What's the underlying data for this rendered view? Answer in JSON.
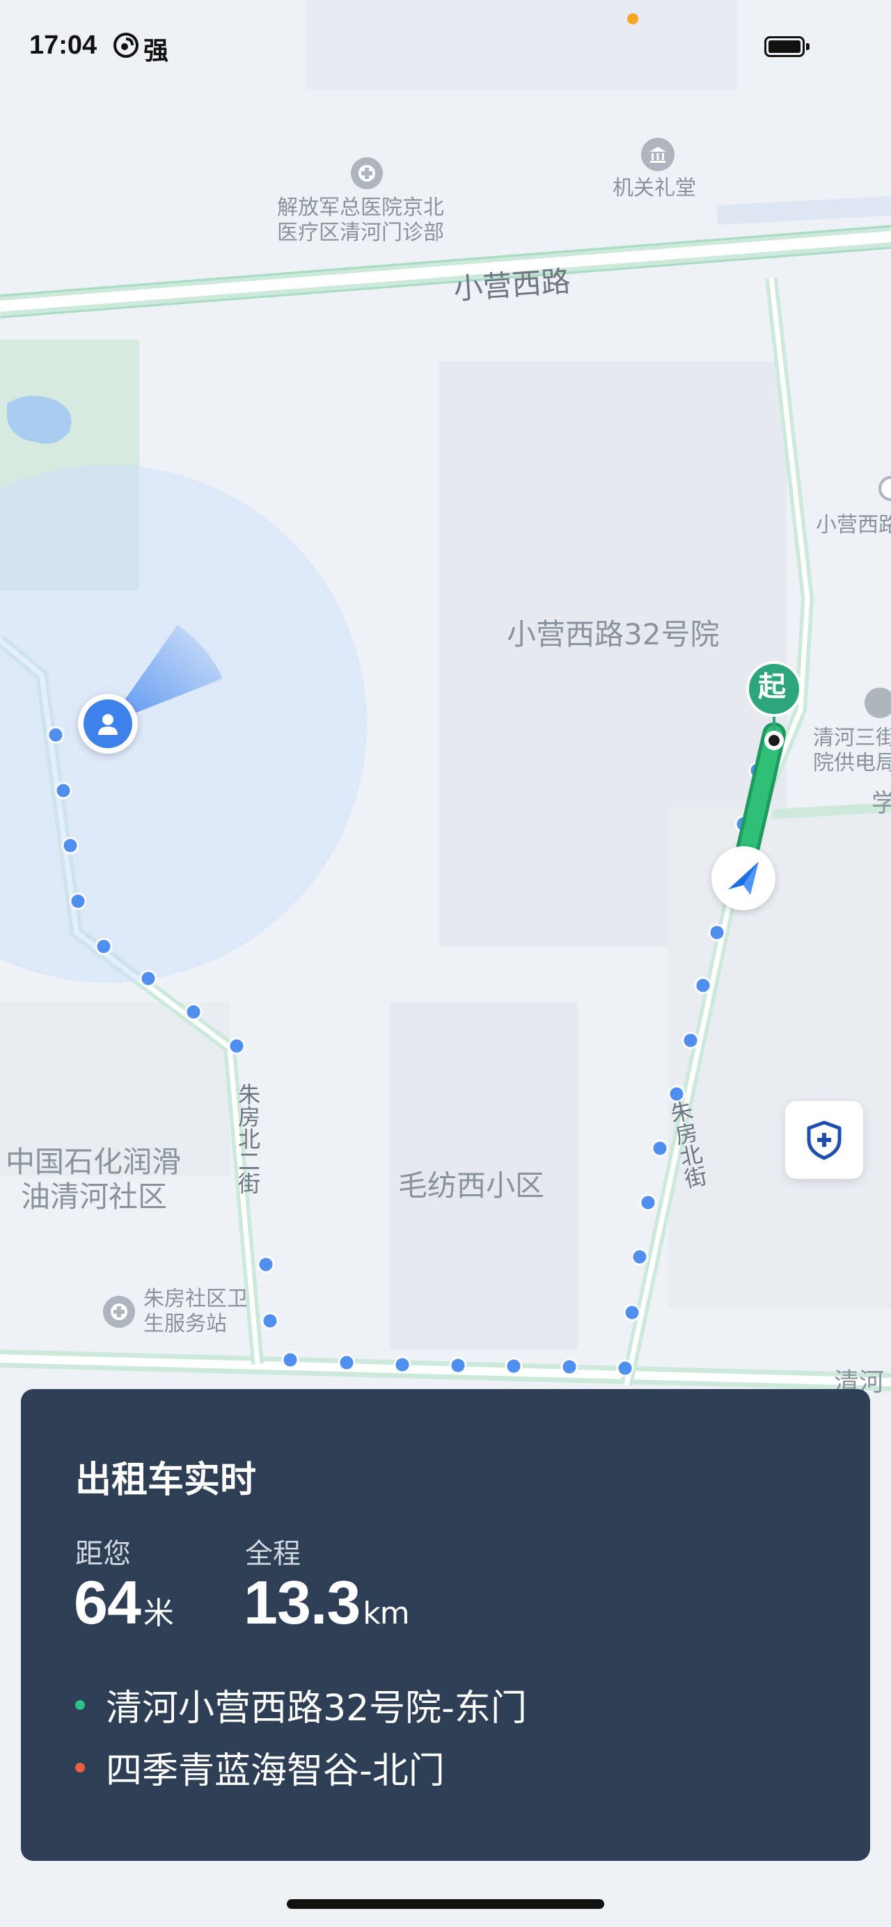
{
  "status_bar": {
    "time": "17:04",
    "carrier": "强"
  },
  "map": {
    "roads": {
      "xiaoying_west_road": "小营西路",
      "zhufang_north_2nd_street": "朱房北二街",
      "zhufang_north_street": "朱房北街",
      "qinghe_partial": "清河",
      "xue_partial": "学"
    },
    "pois": {
      "hospital": "解放军总医院京北医疗区清河门诊部",
      "hospital_line1": "解放军总医院京北",
      "hospital_line2": "医疗区清河门诊部",
      "auditorium": "机关礼堂",
      "compound_32": "小营西路32号院",
      "xiaoying_west_partial": "小营西路",
      "power_supply_line1": "清河三街",
      "power_supply_line2": "院供电局",
      "sinopec_line1": "中国石化润滑",
      "sinopec_line2": "油清河社区",
      "maofang": "毛纺西小区",
      "clinic_line1": "朱房社区卫",
      "clinic_line2": "生服务站"
    },
    "start_marker": "起",
    "colors": {
      "route": "#2fbf77",
      "walk_dots": "#4f8ff0",
      "start_badge": "#2ea67c"
    }
  },
  "taxi_card": {
    "title": "出租车实时",
    "distance_label": "距您",
    "distance_value": "64",
    "distance_unit": "米",
    "total_label": "全程",
    "total_value": "13.3",
    "total_unit": "km",
    "pickup": "清河小营西路32号院-东门",
    "dropoff": "四季青蓝海智谷-北门",
    "pickup_color": "#2fc08a",
    "dropoff_color": "#e8603c"
  },
  "icons": {
    "safety": "shield-plus-icon",
    "user": "user-location-icon",
    "car": "navigation-arrow-icon",
    "hospital": "medical-cross-icon",
    "auditorium": "government-building-icon"
  }
}
